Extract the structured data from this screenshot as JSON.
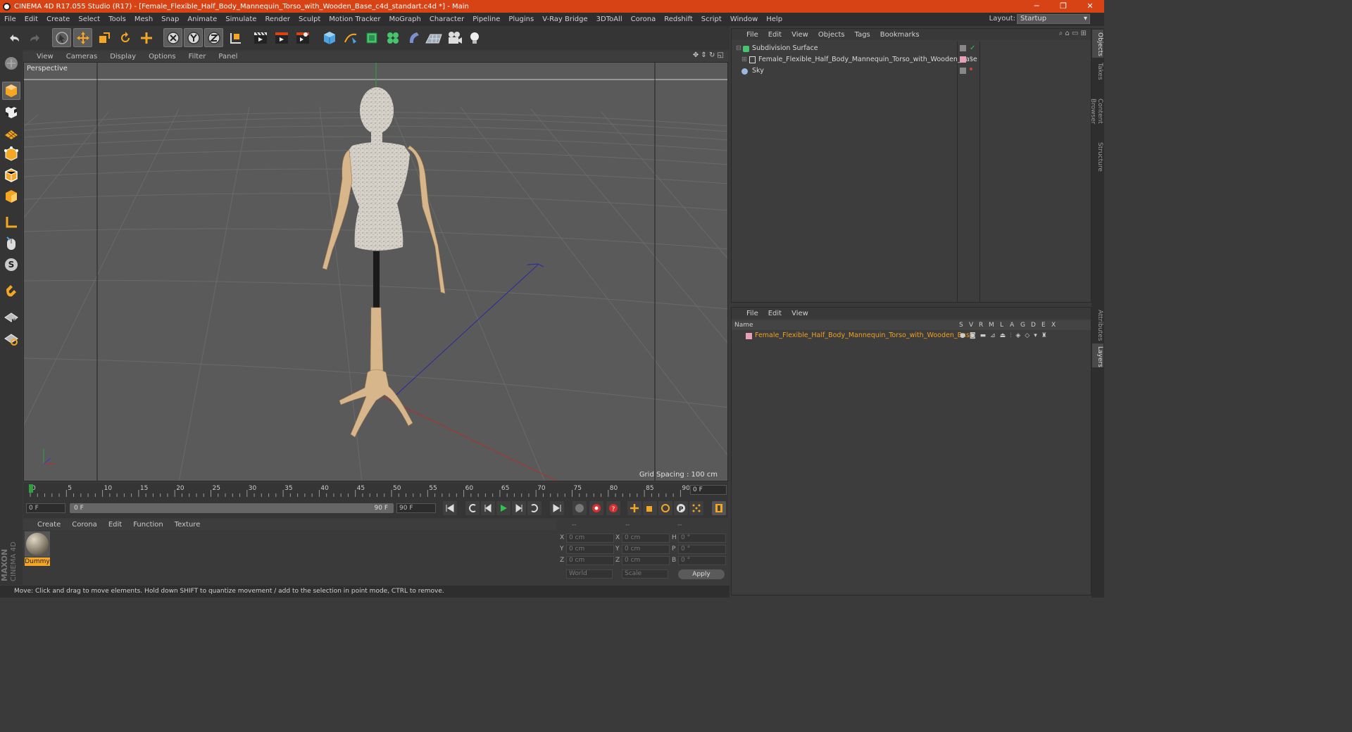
{
  "window": {
    "title": "CINEMA 4D R17.055 Studio (R17) - [Female_Flexible_Half_Body_Mannequin_Torso_with_Wooden_Base_c4d_standart.c4d *] - Main",
    "minimize": "─",
    "restore": "❐",
    "close": "✕"
  },
  "menu": [
    "File",
    "Edit",
    "Create",
    "Select",
    "Tools",
    "Mesh",
    "Snap",
    "Animate",
    "Simulate",
    "Render",
    "Sculpt",
    "Motion Tracker",
    "MoGraph",
    "Character",
    "Pipeline",
    "Plugins",
    "V-Ray Bridge",
    "3DToAll",
    "Corona",
    "Redshift",
    "Script",
    "Window",
    "Help"
  ],
  "layout": {
    "label": "Layout:",
    "value": "Startup"
  },
  "viewport": {
    "menu": [
      "View",
      "Cameras",
      "Display",
      "Options",
      "Filter",
      "Panel"
    ],
    "name": "Perspective",
    "grid_spacing": "Grid Spacing : 100 cm"
  },
  "timeline": {
    "ticks": [
      "0",
      "5",
      "10",
      "15",
      "20",
      "25",
      "30",
      "35",
      "40",
      "45",
      "50",
      "55",
      "60",
      "65",
      "70",
      "75",
      "80",
      "85",
      "90"
    ],
    "current_frame": "0 F",
    "start": "0 F",
    "range_start": "0 F",
    "range_end": "90 F",
    "end": "90 F"
  },
  "material_manager": {
    "menu": [
      "Create",
      "Corona",
      "Edit",
      "Function",
      "Texture"
    ],
    "materials": [
      {
        "name": "Dummy"
      }
    ]
  },
  "coordinates": {
    "headers": [
      "--",
      "--",
      "--"
    ],
    "rows": [
      {
        "a_label": "X",
        "a_val": "0 cm",
        "b_label": "X",
        "b_val": "0 cm",
        "c_label": "H",
        "c_val": "0 °"
      },
      {
        "a_label": "Y",
        "a_val": "0 cm",
        "b_label": "Y",
        "b_val": "0 cm",
        "c_label": "P",
        "c_val": "0 °"
      },
      {
        "a_label": "Z",
        "a_val": "0 cm",
        "b_label": "Z",
        "b_val": "0 cm",
        "c_label": "B",
        "c_val": "0 °"
      }
    ],
    "mode1": "World",
    "mode2": "Scale",
    "apply": "Apply"
  },
  "status": "Move: Click and drag to move elements. Hold down SHIFT to quantize movement / add to the selection in point mode, CTRL to remove.",
  "object_manager": {
    "menu": [
      "File",
      "Edit",
      "View",
      "Objects",
      "Tags",
      "Bookmarks"
    ],
    "objects": [
      {
        "name": "Subdivision Surface"
      },
      {
        "name": "Female_Flexible_Half_Body_Mannequin_Torso_with_Wooden_Base"
      },
      {
        "name": "Sky"
      }
    ]
  },
  "layer_manager": {
    "menu": [
      "File",
      "Edit",
      "View"
    ],
    "header_name": "Name",
    "flags": [
      "S",
      "V",
      "R",
      "M",
      "L",
      "A",
      "G",
      "D",
      "E",
      "X"
    ],
    "layers": [
      {
        "name": "Female_Flexible_Half_Body_Mannequin_Torso_with_Wooden_Base"
      }
    ]
  },
  "right_tabs": [
    "Objects",
    "Takes",
    "Content Browser",
    "Structure",
    "Attributes",
    "Layers"
  ],
  "brand": {
    "maxon": "MAXON",
    "c4d": "CINEMA 4D"
  },
  "colors": {
    "accent": "#d84315",
    "layer_name": "#f0a020",
    "selection": "#f5a623"
  }
}
